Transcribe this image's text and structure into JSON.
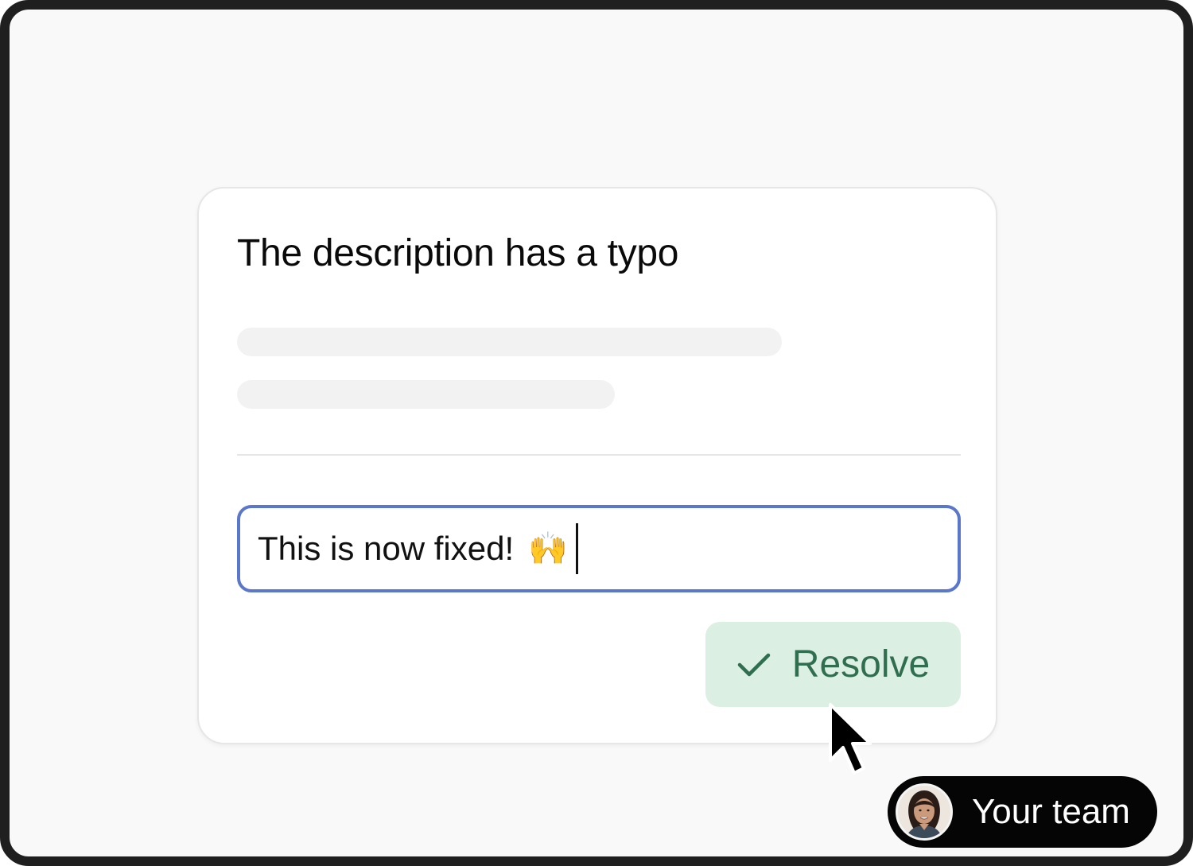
{
  "card": {
    "title": "The description has a typo"
  },
  "comment_input": {
    "value": "This is now fixed!",
    "emoji": "🙌"
  },
  "resolve_button": {
    "label": "Resolve",
    "icon": "check-icon",
    "background": "#dcefe3",
    "text_color": "#2f6e4f"
  },
  "team_badge": {
    "label": "Your team",
    "avatar": "avatar-photo"
  },
  "colors": {
    "input_focus_border": "#5a77cc",
    "frame_border": "#1f1f1f",
    "background": "#f9f9f9"
  }
}
